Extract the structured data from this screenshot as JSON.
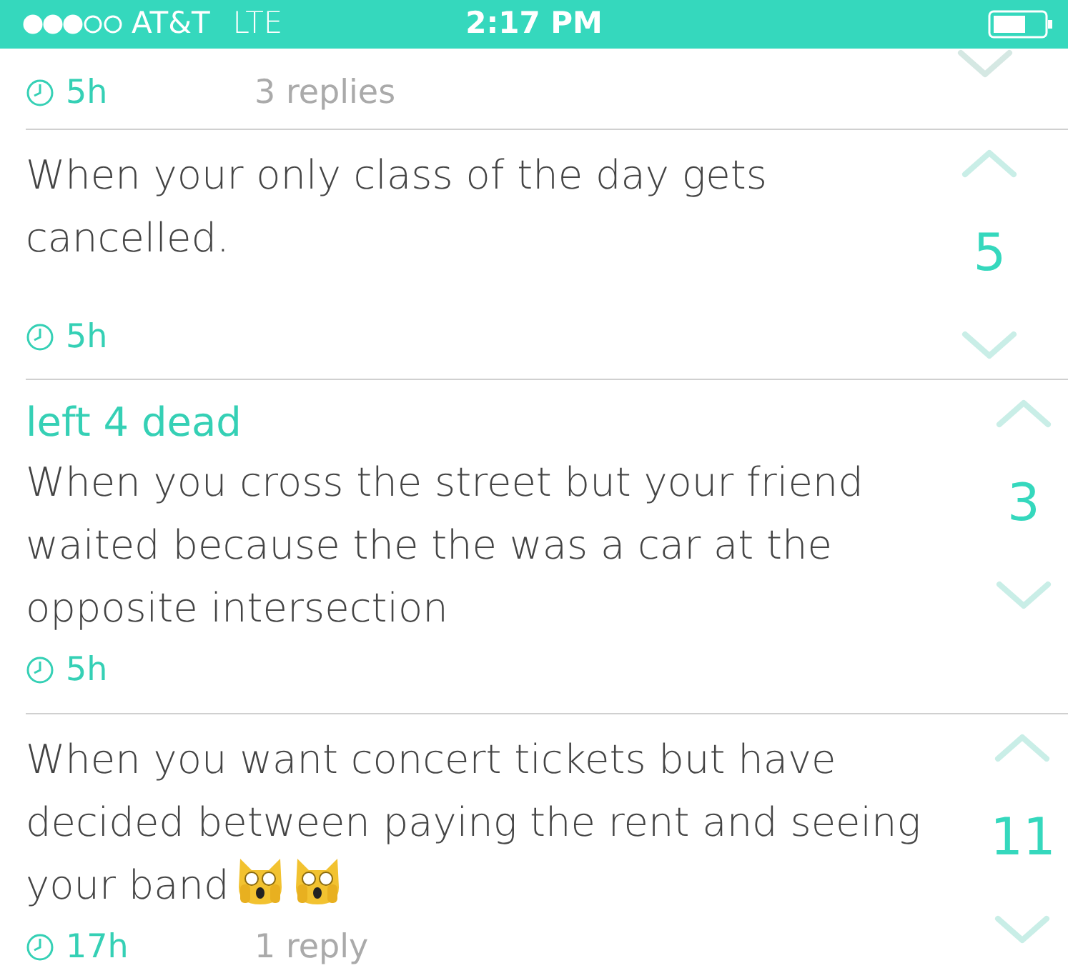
{
  "status_bar": {
    "carrier": "AT&T",
    "network": "LTE",
    "time": "2:17 PM"
  },
  "posts": [
    {
      "kind": "partial",
      "time": "5h",
      "replies": "3 replies"
    },
    {
      "kind": "full",
      "text": "When your only class of the day gets cancelled.",
      "time": "5h",
      "count": "5"
    },
    {
      "kind": "full",
      "title": "left 4 dead",
      "text": "When you cross the street but your friend waited because the the was a car at the opposite intersection",
      "time": "5h",
      "count": "3"
    },
    {
      "kind": "full",
      "text": "When you want concert tickets but have decided between paying the rent and seeing your band",
      "trailing_icons": [
        {
          "kind": "cat"
        },
        {
          "kind": "cat"
        }
      ],
      "time": "17h",
      "replies": "1 reply",
      "count": "11"
    }
  ]
}
